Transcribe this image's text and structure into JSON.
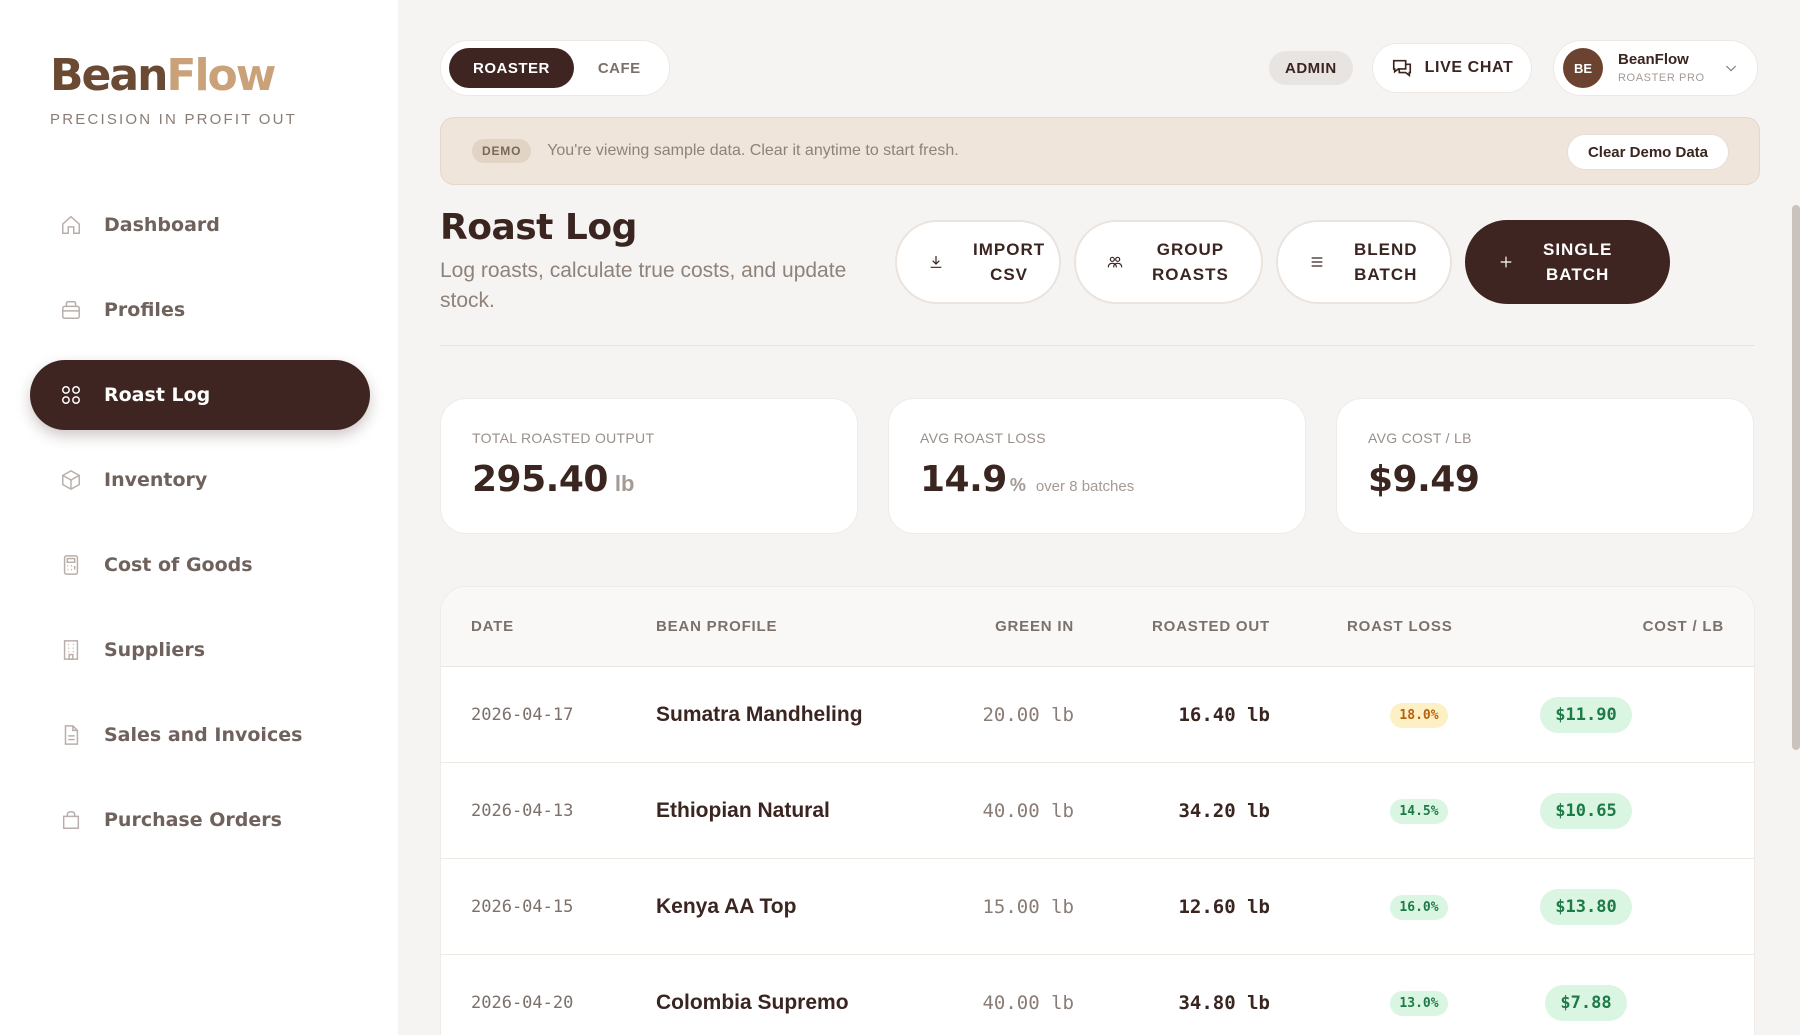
{
  "brand": {
    "part1": "Bean",
    "part2": "Flow",
    "tagline": "PRECISION IN PROFIT OUT"
  },
  "sidebar": {
    "items": [
      {
        "label": "Dashboard",
        "icon": "home-icon",
        "active": false
      },
      {
        "label": "Profiles",
        "icon": "profile-card-icon",
        "active": false
      },
      {
        "label": "Roast Log",
        "icon": "grid-icon",
        "active": true
      },
      {
        "label": "Inventory",
        "icon": "box-icon",
        "active": false
      },
      {
        "label": "Cost of Goods",
        "icon": "calculator-icon",
        "active": false
      },
      {
        "label": "Suppliers",
        "icon": "building-icon",
        "active": false
      },
      {
        "label": "Sales and Invoices",
        "icon": "document-icon",
        "active": false
      },
      {
        "label": "Purchase Orders",
        "icon": "bag-icon",
        "active": false
      }
    ]
  },
  "header": {
    "modes": [
      "ROASTER",
      "CAFE"
    ],
    "active_mode": "ROASTER",
    "admin_label": "ADMIN",
    "live_chat_label": "LIVE CHAT",
    "user": {
      "initials": "BE",
      "name": "BeanFlow",
      "role": "ROASTER PRO"
    }
  },
  "demo_banner": {
    "tag": "DEMO",
    "text": "You're viewing sample data. Clear it anytime to start fresh.",
    "clear_label": "Clear Demo Data"
  },
  "page": {
    "title": "Roast Log",
    "subtitle": "Log roasts, calculate true costs, and update stock."
  },
  "actions": {
    "import": {
      "line1": "IMPORT",
      "line2": "CSV"
    },
    "group": {
      "line1": "GROUP",
      "line2": "ROASTS"
    },
    "blend": {
      "line1": "BLEND",
      "line2": "BATCH"
    },
    "single": {
      "line1": "SINGLE",
      "line2": "BATCH"
    }
  },
  "stats": {
    "total_output": {
      "label": "TOTAL ROASTED OUTPUT",
      "value": "295.40",
      "unit": "lb"
    },
    "avg_loss": {
      "label": "AVG ROAST LOSS",
      "value": "14.9",
      "unit": "%",
      "note": "over 8 batches"
    },
    "avg_cost": {
      "label": "AVG COST / LB",
      "value": "$9.49"
    }
  },
  "table": {
    "headers": {
      "date": "DATE",
      "bean": "BEAN PROFILE",
      "green": "GREEN IN",
      "roasted": "ROASTED OUT",
      "loss": "ROAST LOSS",
      "cost": "COST / LB"
    },
    "rows": [
      {
        "date": "2026-04-17",
        "bean": "Sumatra Mandheling",
        "green": "20.00 lb",
        "roasted": "16.40 lb",
        "loss": "18.0%",
        "loss_level": "warn",
        "cost": "$11.90"
      },
      {
        "date": "2026-04-13",
        "bean": "Ethiopian Natural",
        "green": "40.00 lb",
        "roasted": "34.20 lb",
        "loss": "14.5%",
        "loss_level": "ok",
        "cost": "$10.65"
      },
      {
        "date": "2026-04-15",
        "bean": "Kenya AA Top",
        "green": "15.00 lb",
        "roasted": "12.60 lb",
        "loss": "16.0%",
        "loss_level": "ok",
        "cost": "$13.80"
      },
      {
        "date": "2026-04-20",
        "bean": "Colombia Supremo",
        "green": "40.00 lb",
        "roasted": "34.80 lb",
        "loss": "13.0%",
        "loss_level": "ok",
        "cost": "$7.88"
      }
    ]
  },
  "colors": {
    "accent_dark": "#3f2521",
    "brand_light": "#c9a27a",
    "loss_warn_bg": "#fdf0c4",
    "loss_warn_fg": "#b5620e",
    "loss_ok_bg": "#daf5e2",
    "loss_ok_fg": "#1e7a47"
  }
}
